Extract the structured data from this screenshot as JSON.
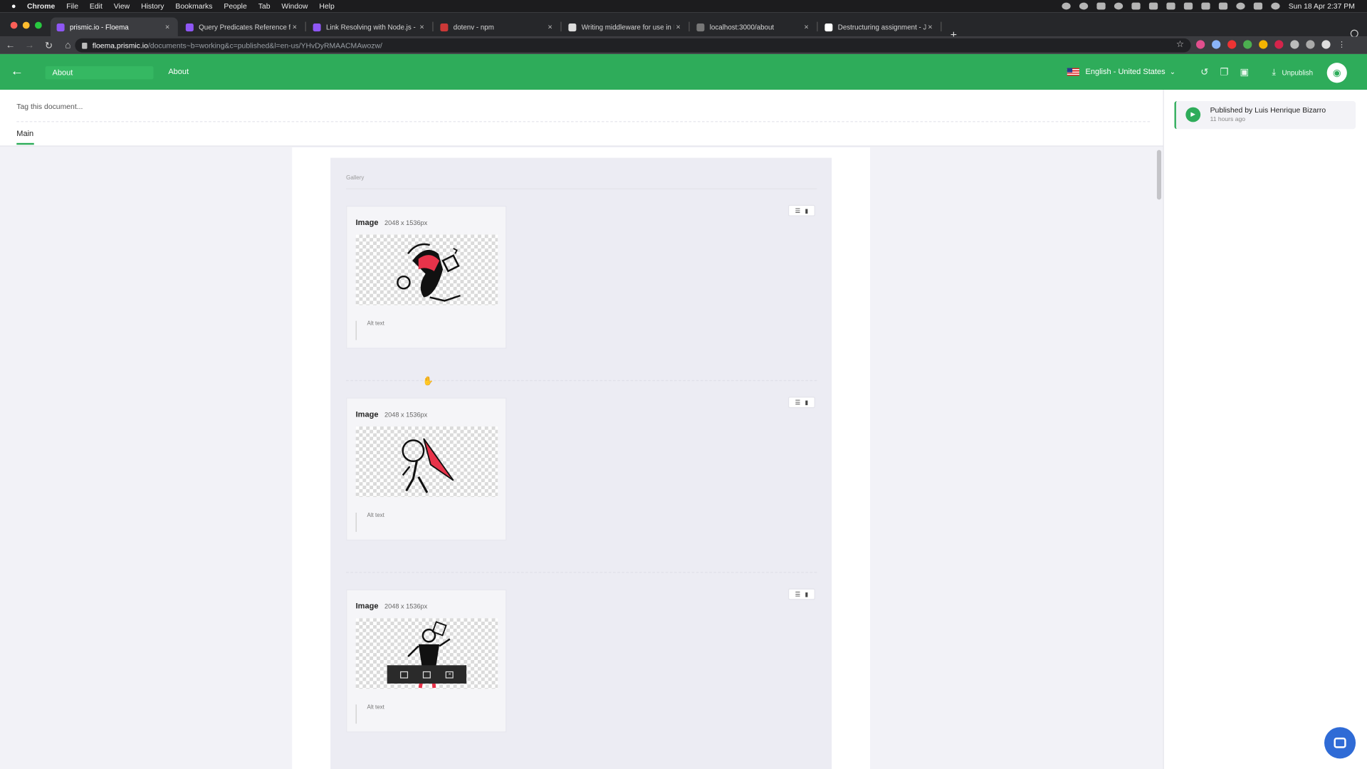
{
  "menubar": {
    "items": [
      "Chrome",
      "File",
      "Edit",
      "View",
      "History",
      "Bookmarks",
      "People",
      "Tab",
      "Window",
      "Help"
    ],
    "clock": "Sun 18 Apr  2:37 PM"
  },
  "tabs": [
    {
      "title": "prismic.io - Floema",
      "favicon_color": "#8f57f5",
      "active": true
    },
    {
      "title": "Query Predicates Reference fo",
      "favicon_color": "#8f57f5",
      "active": false
    },
    {
      "title": "Link Resolving with Node.js - F",
      "favicon_color": "#8f57f5",
      "active": false
    },
    {
      "title": "dotenv - npm",
      "favicon_color": "#cb3837",
      "active": false
    },
    {
      "title": "Writing middleware for use in E",
      "favicon_color": "#dddddd",
      "active": false
    },
    {
      "title": "localhost:3000/about",
      "favicon_color": "#777777",
      "active": false
    },
    {
      "title": "Destructuring assignment - Ja",
      "favicon_color": "#ffffff",
      "active": false
    }
  ],
  "url": {
    "domain": "floema.prismic.io",
    "path": "/documents~b=working&c=published&l=en-us/YHvDyRMAACMAwozw/"
  },
  "header": {
    "document_name": "About",
    "breadcrumb": "About",
    "language": "English - United States",
    "unpublish_label": "Unpublish"
  },
  "document": {
    "tag_placeholder": "Tag this document...",
    "tab_label": "Main",
    "gallery_label": "Gallery",
    "images": [
      {
        "label": "Image",
        "dimensions": "2048 x 1536px",
        "alt_placeholder": "Alt text"
      },
      {
        "label": "Image",
        "dimensions": "2048 x 1536px",
        "alt_placeholder": "Alt text"
      },
      {
        "label": "Image",
        "dimensions": "2048 x 1536px",
        "alt_placeholder": "Alt text"
      }
    ]
  },
  "sidebar": {
    "status_title": "Published by Luis Henrique Bizarro",
    "status_time": "11 hours ago"
  },
  "colors": {
    "brand_green": "#2eac5a",
    "chat_blue": "#2f6bd6",
    "accent_red": "#e8334a"
  },
  "icons": {
    "back": "arrow-left-icon",
    "history": "history-icon",
    "duplicate": "copy-icon",
    "archive": "archive-icon",
    "download": "download-icon",
    "preview": "eye-icon",
    "drag": "drag-handle-icon",
    "delete": "trash-icon",
    "chat": "chat-icon"
  }
}
